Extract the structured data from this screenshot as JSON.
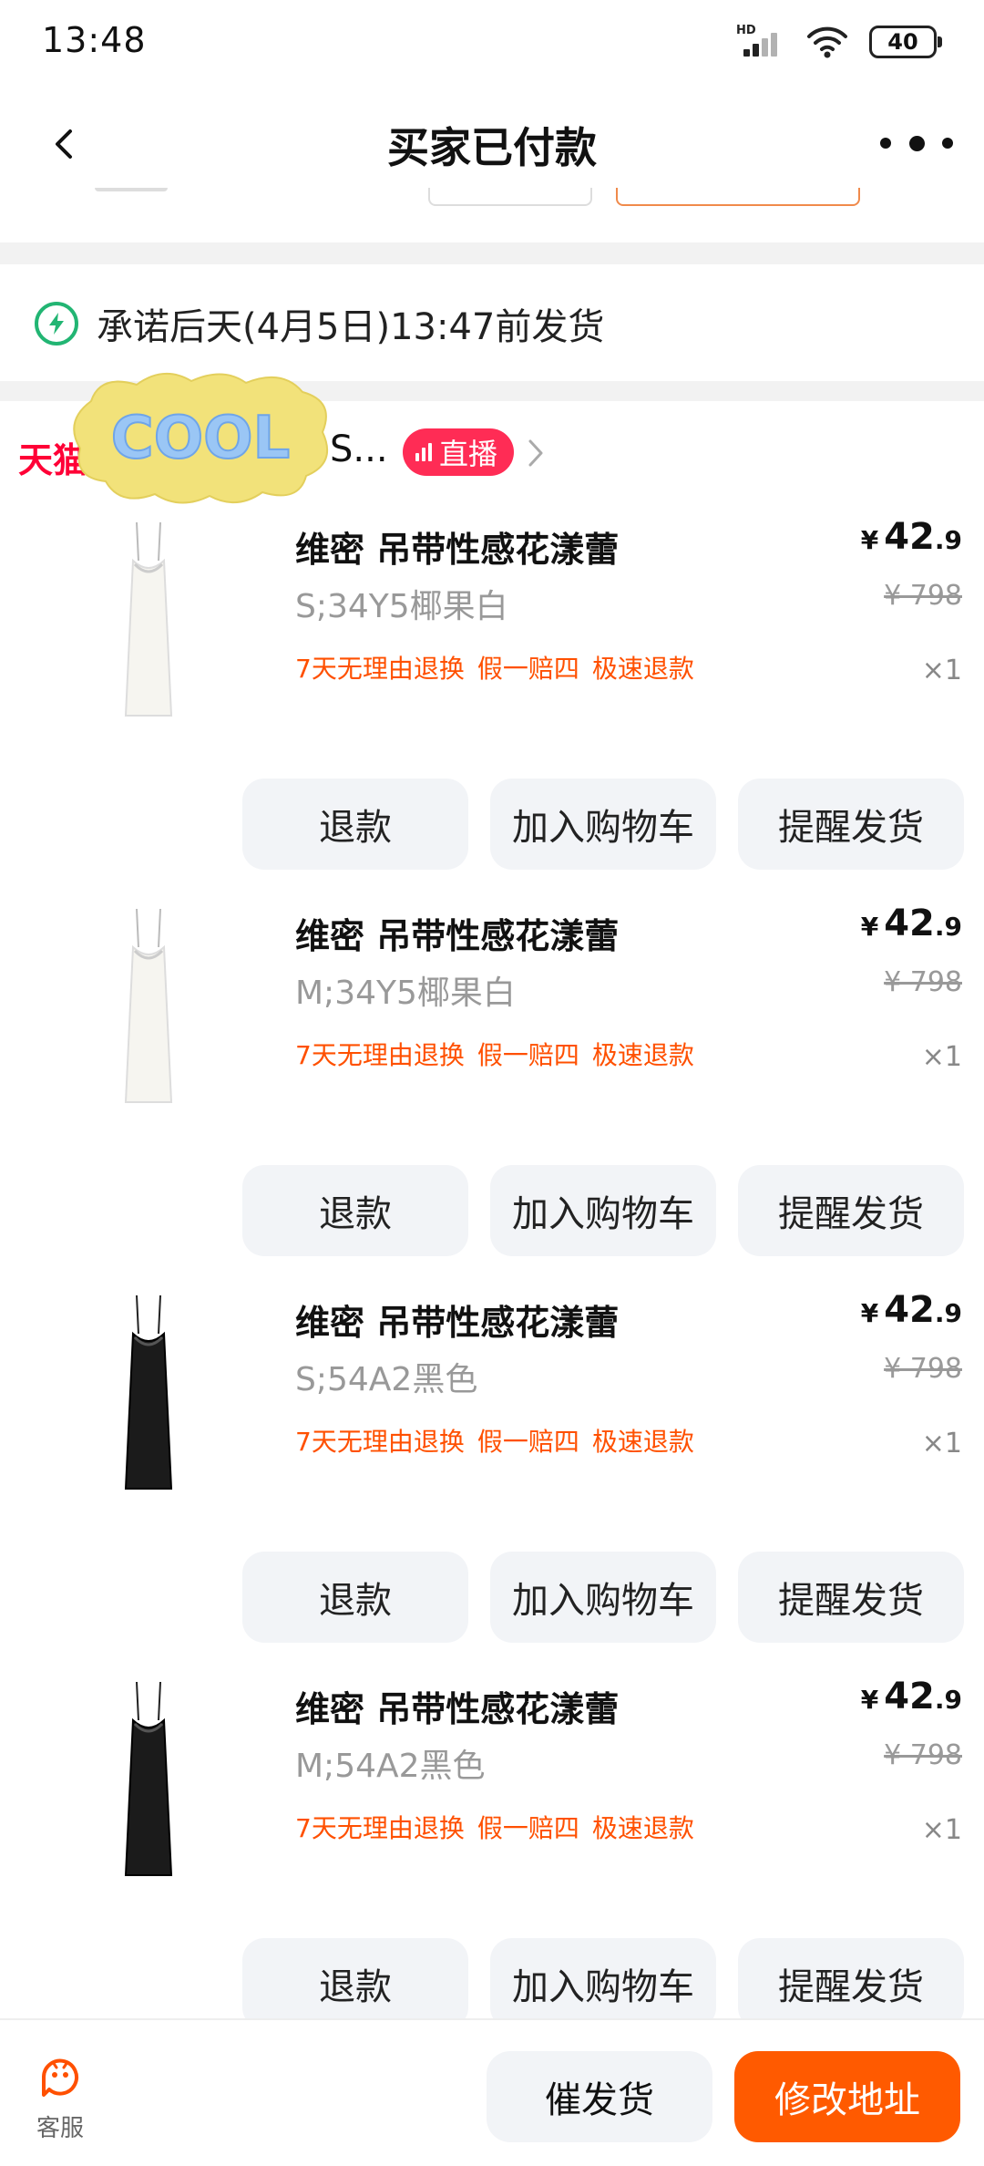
{
  "status_bar": {
    "time": "13:48",
    "network_label": "HD",
    "battery": "40"
  },
  "nav": {
    "title": "买家已付款"
  },
  "promise": {
    "text": "承诺后天(4月5日)13:47前发货"
  },
  "shop": {
    "logo_text": "天猫",
    "name": "S...",
    "live_label": "直播",
    "sticker_text": "COOL",
    "colors": {
      "live_badge": "#ff2c55",
      "logo": "#ff0036"
    }
  },
  "products": [
    {
      "title": "维密 吊带性感花漾蕾",
      "sku": "S;34Y5椰果白",
      "dress_color": "white",
      "tags": [
        "7天无理由退换",
        "假一赔四",
        "极速退款"
      ],
      "price": {
        "currency": "¥",
        "integer": "42",
        "decimal": ".9",
        "original": "¥ 798"
      },
      "qty": "×1",
      "actions": {
        "refund": "退款",
        "add_cart": "加入购物车",
        "remind": "提醒发货"
      }
    },
    {
      "title": "维密 吊带性感花漾蕾",
      "sku": "M;34Y5椰果白",
      "dress_color": "white",
      "tags": [
        "7天无理由退换",
        "假一赔四",
        "极速退款"
      ],
      "price": {
        "currency": "¥",
        "integer": "42",
        "decimal": ".9",
        "original": "¥ 798"
      },
      "qty": "×1",
      "actions": {
        "refund": "退款",
        "add_cart": "加入购物车",
        "remind": "提醒发货"
      }
    },
    {
      "title": "维密 吊带性感花漾蕾",
      "sku": "S;54A2黑色",
      "dress_color": "black",
      "tags": [
        "7天无理由退换",
        "假一赔四",
        "极速退款"
      ],
      "price": {
        "currency": "¥",
        "integer": "42",
        "decimal": ".9",
        "original": "¥ 798"
      },
      "qty": "×1",
      "actions": {
        "refund": "退款",
        "add_cart": "加入购物车",
        "remind": "提醒发货"
      }
    },
    {
      "title": "维密 吊带性感花漾蕾",
      "sku": "M;54A2黑色",
      "dress_color": "black",
      "tags": [
        "7天无理由退换",
        "假一赔四",
        "极速退款"
      ],
      "price": {
        "currency": "¥",
        "integer": "42",
        "decimal": ".9",
        "original": "¥ 798"
      },
      "qty": "×1",
      "actions": {
        "refund": "退款",
        "add_cart": "加入购物车",
        "remind": "提醒发货"
      }
    }
  ],
  "bottom_bar": {
    "service_label": "客服",
    "urge_label": "催发货",
    "address_label": "修改地址",
    "colors": {
      "primary": "#ff5a00"
    }
  }
}
